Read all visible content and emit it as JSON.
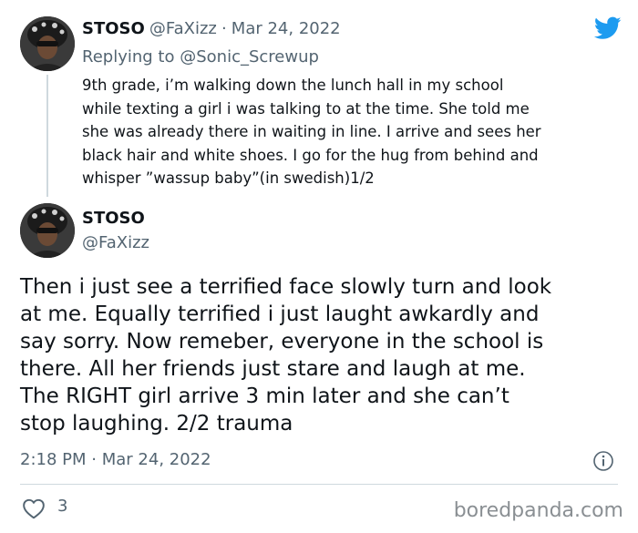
{
  "reply_tweet": {
    "name": "STOSO",
    "handle": "@FaXizz",
    "separator": "·",
    "date": "Mar 24, 2022",
    "replying_prefix": "Replying to",
    "replying_to": "@Sonic_Screwup",
    "text": "9th grade, i’m walking down the lunch hall in my school\nwhile texting a girl i was talking to at the time. She told me\nshe was already there in waiting in line. I arrive and sees her\nblack hair and white shoes. I go for the hug from behind and\nwhisper ”wassup baby”(in swedish)1/2"
  },
  "main_tweet": {
    "name": "STOSO",
    "handle": "@FaXizz",
    "text": "Then i just see a terrified face slowly turn and look\nat me. Equally terrified i just laught awkardly and\nsay sorry. Now remeber, everyone in the school is\nthere. All her friends just stare and laugh at me.\nThe RIGHT girl arrive 3 min later and she can’t\nstop laughing. 2/2 trauma",
    "time": "2:18 PM",
    "separator": "·",
    "date": "Mar 24, 2022",
    "like_count": "3"
  },
  "watermark": "boredpanda.com",
  "icons": {
    "twitter": "twitter-bird-icon",
    "info": "info-icon",
    "heart": "heart-icon"
  },
  "colors": {
    "twitter_blue": "#1d9bf0",
    "secondary_text": "#536471",
    "divider": "#cfd9de"
  }
}
